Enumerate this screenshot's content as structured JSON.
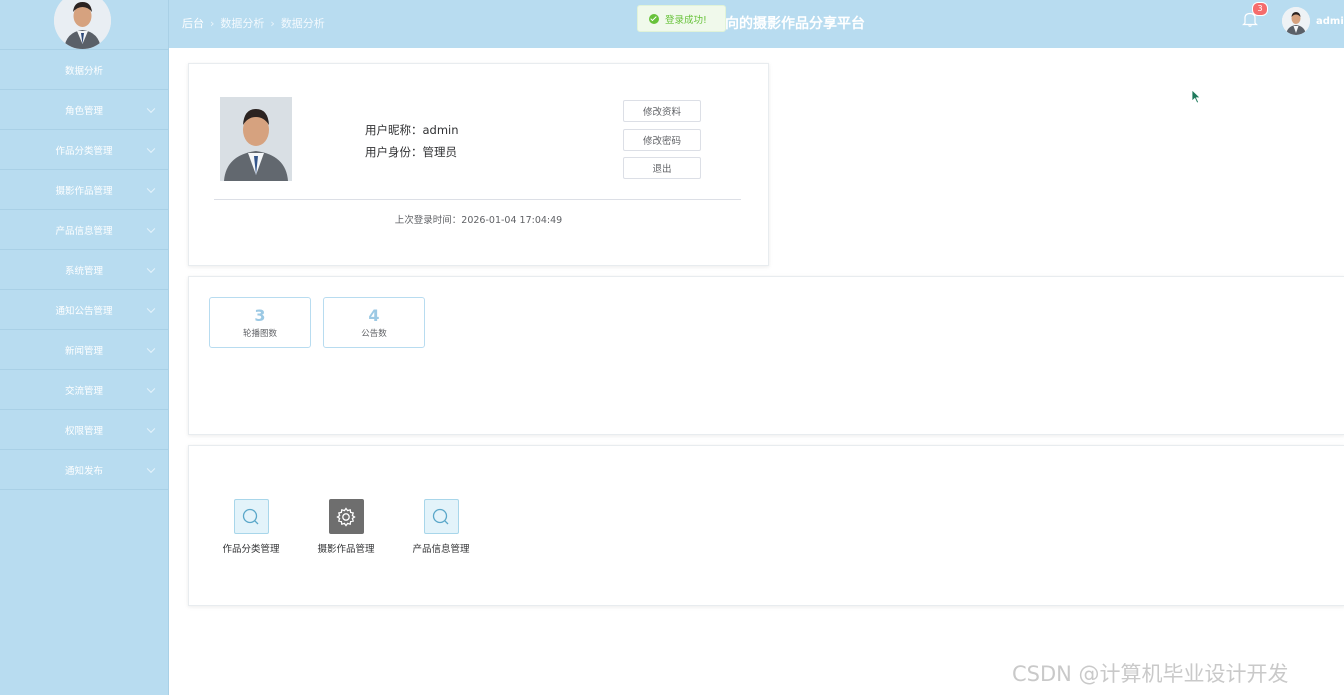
{
  "sidebar": {
    "items": [
      {
        "label": "数据分析",
        "has_arrow": false
      },
      {
        "label": "角色管理",
        "has_arrow": true
      },
      {
        "label": "作品分类管理",
        "has_arrow": true
      },
      {
        "label": "摄影作品管理",
        "has_arrow": true
      },
      {
        "label": "产品信息管理",
        "has_arrow": true
      },
      {
        "label": "系统管理",
        "has_arrow": true
      },
      {
        "label": "通知公告管理",
        "has_arrow": true
      },
      {
        "label": "新闻管理",
        "has_arrow": true
      },
      {
        "label": "交流管理",
        "has_arrow": true
      },
      {
        "label": "权限管理",
        "has_arrow": true
      },
      {
        "label": "通知发布",
        "has_arrow": true
      }
    ]
  },
  "header": {
    "breadcrumb": [
      "后台",
      "数据分析",
      "数据分析"
    ],
    "site_title": "向的摄影作品分享平台",
    "notification_count": "3",
    "username": "admi"
  },
  "toast": {
    "message": "登录成功!"
  },
  "profile": {
    "nickname_line": "用户昵称：admin",
    "role_line": "用户身份：管理员",
    "buttons": {
      "edit_profile": "修改资料",
      "change_password": "修改密码",
      "logout": "退出"
    },
    "last_login": "上次登录时间：2026-01-04 17:04:49"
  },
  "stats": [
    {
      "value": "3",
      "label": "轮播图数"
    },
    {
      "value": "4",
      "label": "公告数"
    }
  ],
  "quick_links": [
    {
      "label": "作品分类管理",
      "icon": "search-icon"
    },
    {
      "label": "摄影作品管理",
      "icon": "gear-icon"
    },
    {
      "label": "产品信息管理",
      "icon": "search-icon"
    }
  ],
  "watermark": "CSDN @计算机毕业设计开发",
  "colors": {
    "theme": "#b8dcf0",
    "success": "#67c23a",
    "badge": "#f56c6c",
    "stat_number": "#9cc9e4"
  }
}
